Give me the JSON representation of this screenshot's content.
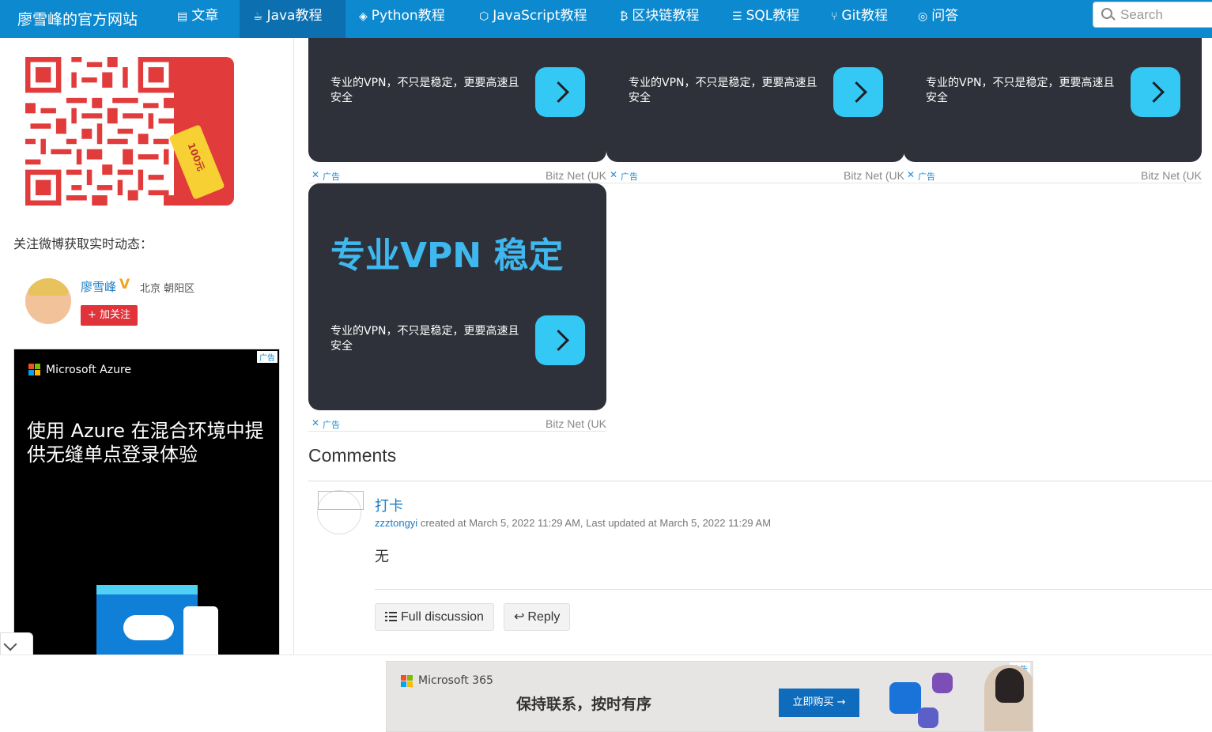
{
  "nav": {
    "brand": "廖雪峰的官方网站",
    "items": [
      {
        "icon": "newspaper-icon",
        "glyph": "▤",
        "label": "文章"
      },
      {
        "icon": "coffee-icon",
        "glyph": "☕",
        "label": "Java教程"
      },
      {
        "icon": "python-icon",
        "glyph": "◈",
        "label": "Python教程"
      },
      {
        "icon": "javascript-icon",
        "glyph": "⬡",
        "label": "JavaScript教程"
      },
      {
        "icon": "bitcoin-icon",
        "glyph": "₿",
        "label": "区块链教程"
      },
      {
        "icon": "database-icon",
        "glyph": "☰",
        "label": "SQL教程"
      },
      {
        "icon": "git-icon",
        "glyph": "⑂",
        "label": "Git教程"
      },
      {
        "icon": "chat-icon",
        "glyph": "◎",
        "label": "问答"
      }
    ],
    "active_index": 1,
    "search_placeholder": "Search"
  },
  "sidebar": {
    "qr_tag": "100元",
    "weibo_label": "关注微博获取实时动态：",
    "weibo_name": "廖雪峰",
    "weibo_verified": "V",
    "weibo_location": "北京 朝阳区",
    "follow_label": "+ 加关注",
    "azure_ad": {
      "tag": "广告",
      "brand": "Microsoft Azure",
      "headline": "使用 Azure 在混合环境中提供无缝单点登录体验"
    }
  },
  "vpn_ads": [
    {
      "text": "专业的VPN，不只是稳定，更要高速且安全",
      "ad_label": "广告",
      "source": "Bitz Net (UK"
    },
    {
      "text": "专业的VPN，不只是稳定，更要高速且安全",
      "ad_label": "广告",
      "source": "Bitz Net (UK"
    },
    {
      "text": "专业的VPN，不只是稳定，更要高速且安全",
      "ad_label": "广告",
      "source": "Bitz Net (UK"
    },
    {
      "headline": "专业VPN 稳定",
      "text": "专业的VPN，不只是稳定，更要高速且安全",
      "ad_label": "广告",
      "source": "Bitz Net (UK"
    }
  ],
  "comments": {
    "title": "Comments",
    "items": [
      {
        "title": "打卡",
        "user": "zzztongyi",
        "meta": " created at March 5, 2022 11:29 AM, Last updated at March 5, 2022 11:29 AM",
        "body": "无"
      }
    ],
    "full_discussion_label": "Full discussion",
    "reply_label": "Reply"
  },
  "bottom_ad": {
    "tag": "广告",
    "brand": "Microsoft 365",
    "slogan": "保持联系，按时有序",
    "cta": "立即购买 →"
  },
  "colors": {
    "nav_bg": "#0d89cf",
    "nav_active": "#0b6fb0",
    "link": "#1b7dc4",
    "vpn_card": "#2e3139",
    "vpn_accent": "#34c8f5",
    "follow_red": "#e0343a"
  }
}
